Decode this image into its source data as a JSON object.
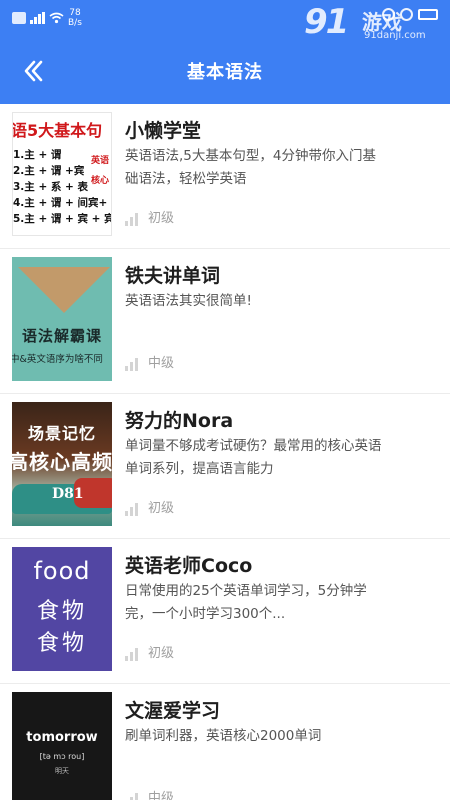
{
  "status_bar": {
    "speed_value": "78",
    "speed_unit": "B/s"
  },
  "watermark": {
    "brand_number": "91",
    "brand_name": "游戏",
    "url": "91danji.com"
  },
  "header": {
    "title": "基本语法",
    "background_color": "#3d7ff3"
  },
  "courses": [
    {
      "author": "小懒学堂",
      "description": "英语语法,5大基本句型，4分钟带你入门基础语法，轻松学英语",
      "level": "初级",
      "thumbnail": {
        "heading": "语5大基本句",
        "lines": [
          "1.主 + 谓",
          "2.主 + 谓 +宾",
          "3.主 + 系 + 表",
          "4.主 + 谓 + 间宾+",
          "5.主 + 谓 + 宾 + 宾"
        ],
        "side_label_1": "英语",
        "side_label_2": "核心"
      }
    },
    {
      "author": "铁夫讲单词",
      "description": "英语语法其实很简单!",
      "level": "中级",
      "thumbnail": {
        "title": "语法解霸课",
        "subtitle": "中&英文语序为啥不同"
      }
    },
    {
      "author": "努力的Nora",
      "description": "单词量不够成考试硬伤？最常用的核心英语单词系列，提高语言能力",
      "level": "初级",
      "thumbnail": {
        "line_1": "场景记忆",
        "line_2": "高核心高频",
        "line_3": "D81"
      }
    },
    {
      "author": "英语老师Coco",
      "description": "日常使用的25个英语单词学习，5分钟学完，一个小时学习300个...",
      "level": "初级",
      "thumbnail": {
        "word": "food",
        "cn_1": "食物",
        "cn_2": "食物"
      }
    },
    {
      "author": "文渥爱学习",
      "description": "刷单词利器，英语核心2000单词",
      "level": "中级",
      "thumbnail": {
        "word": "tomorrow",
        "phonetic": "[tə mɔ rou]",
        "cn": "明天"
      }
    }
  ]
}
